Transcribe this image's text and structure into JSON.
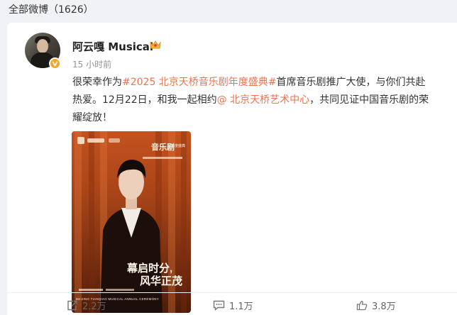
{
  "header": {
    "title": "全部微博（1626）"
  },
  "post": {
    "author": "阿云嘎 Musical",
    "time": "15 小时前",
    "text": {
      "lead": "很荣幸作为",
      "hashtag": "#2025 北京天桥音乐剧年度盛典#",
      "middle": "首席音乐剧推广大使，与你们共赴热爱。12月22日，和我一起相约",
      "mention": "@ 北京天桥艺术中心",
      "end": "，共同见证中国音乐剧的荣耀绽放！"
    },
    "poster": {
      "title": "音乐剧",
      "subtitle": "年度盛典",
      "slogan_line1": "幕启时分,",
      "slogan_line2": "风华正茂",
      "footer": "BEIJING TIANQIAO MUSICAL ANNUAL CEREMONY"
    }
  },
  "actions": {
    "repost": "2.2万",
    "comment": "1.1万",
    "like": "3.8万"
  },
  "colors": {
    "link": "#eb7350",
    "poster_orange": "#c3521f",
    "vip_gold": "#f6a623"
  }
}
